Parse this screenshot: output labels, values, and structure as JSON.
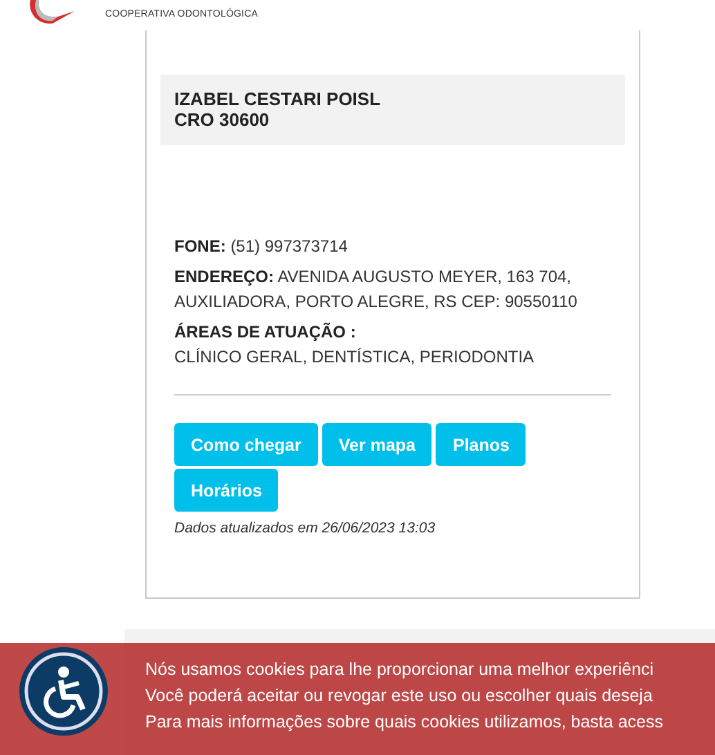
{
  "header": {
    "tagline": "COOPERATIVA ODONTOLÓGICA"
  },
  "card": {
    "name": "IZABEL CESTARI POISL",
    "registration": "CRO 30600",
    "details": [
      {
        "kind": "inline",
        "label": "FONE:",
        "value": "(51) 997373714"
      },
      {
        "kind": "inline",
        "label": "ENDEREÇO:",
        "value": "AVENIDA AUGUSTO MEYER, 163 704, AUXILIADORA, PORTO ALEGRE, RS CEP: 90550110"
      },
      {
        "kind": "stacked",
        "label": "ÁREAS DE ATUAÇÃO :",
        "value": "CLÍNICO GERAL, DENTÍSTICA, PERIODONTIA"
      }
    ],
    "buttons": [
      "Como chegar",
      "Ver mapa",
      "Planos",
      "Horários"
    ],
    "updated": "Dados atualizados em 26/06/2023 13:03"
  },
  "cookie_banner": {
    "lines": [
      "Nós usamos cookies para lhe proporcionar uma melhor experiênci",
      "Você poderá aceitar ou revogar este uso ou escolher quais deseja",
      "Para mais informações sobre quais cookies utilizamos, basta acess"
    ]
  }
}
